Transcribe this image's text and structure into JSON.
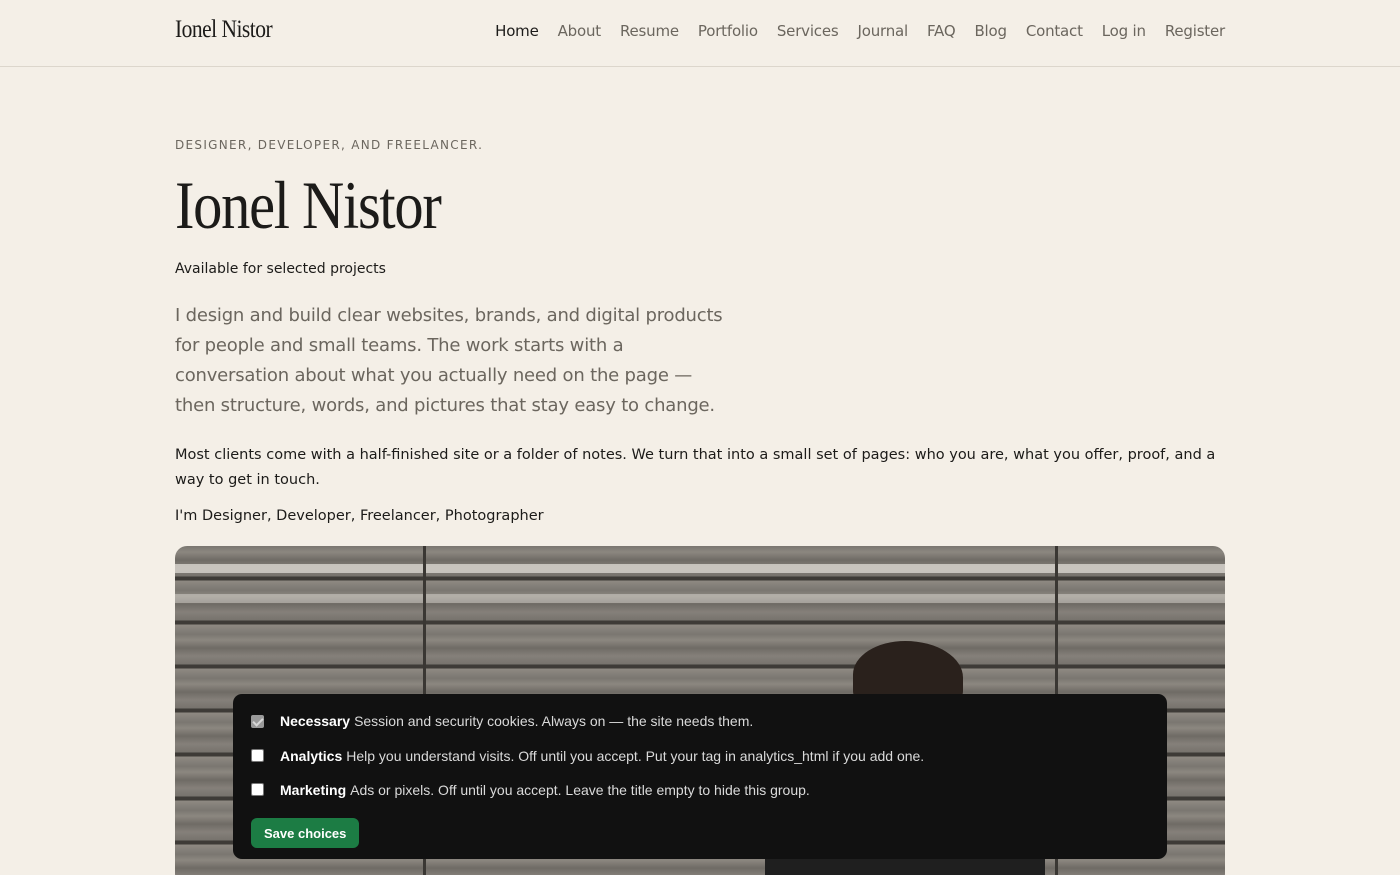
{
  "header": {
    "brand": "Ionel Nistor",
    "nav": [
      "Home",
      "About",
      "Resume",
      "Portfolio",
      "Services",
      "Journal",
      "FAQ",
      "Blog",
      "Contact",
      "Log in",
      "Register"
    ],
    "active": "Home"
  },
  "hero": {
    "eyebrow": "DESIGNER, DEVELOPER, AND FREELANCER.",
    "title": "Ionel Nistor",
    "availability": "Available for selected projects",
    "lead": "I design and build clear websites, brands, and digital products for people and small teams. The work starts with a conversation about what you actually need on the page — then structure, words, and pictures that stay easy to change.",
    "body": "Most clients come with a half-finished site or a folder of notes. We turn that into a small set of pages: who you are, what you offer, proof, and a way to get in touch.",
    "roles": "I'm Designer, Developer, Freelancer, Photographer"
  },
  "consent": {
    "groups": [
      {
        "title": "Necessary",
        "description": "Session and security cookies. Always on — the site needs them.",
        "checked": true,
        "disabled": true
      },
      {
        "title": "Analytics",
        "description": "Help you understand visits. Off until you accept. Put your tag in analytics_html if you add one.",
        "checked": false,
        "disabled": false
      },
      {
        "title": "Marketing",
        "description": "Ads or pixels. Off until you accept. Leave the title empty to hide this group.",
        "checked": false,
        "disabled": false
      }
    ],
    "save_label": "Save choices"
  },
  "colors": {
    "background": "#f4efe7",
    "text": "#1c1b19",
    "muted": "#6b665e",
    "consent_bg": "#111111",
    "button": "#1c7c44"
  }
}
